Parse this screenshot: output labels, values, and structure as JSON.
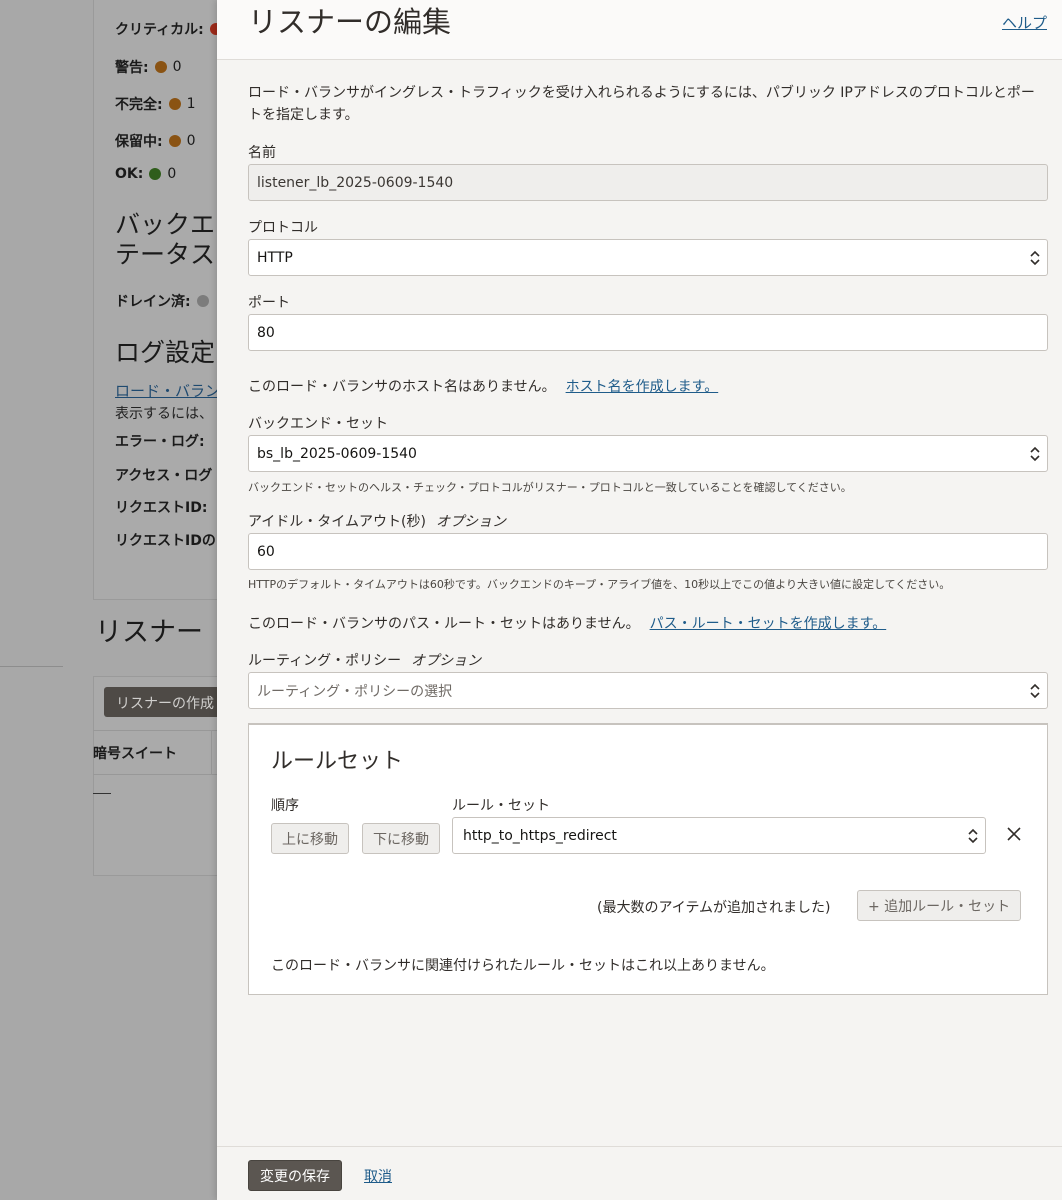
{
  "background": {
    "status": [
      {
        "label": "クリティカル:",
        "value": "",
        "color": "red"
      },
      {
        "label": "警告:",
        "value": "0",
        "color": "orange"
      },
      {
        "label": "不完全:",
        "value": "1",
        "color": "orange"
      },
      {
        "label": "保留中:",
        "value": "0",
        "color": "orange"
      },
      {
        "label": "OK:",
        "value": "0",
        "color": "green"
      }
    ],
    "backend_status_heading_1": "バックエ",
    "backend_status_heading_2": "テータス",
    "drained_label": "ドレイン済:",
    "log_heading": "ログ設定",
    "log_link": "ロード・バラン",
    "log_text": "表示するには、",
    "error_log": "エラー・ログ: ",
    "access_log": "アクセス・ログ",
    "request_id": "リクエストID: ",
    "request_id_2": "リクエストIDの",
    "listener_heading": "リスナー",
    "create_listener_button": "リスナーの作成",
    "cipher_suite_col": "暗号スイート"
  },
  "panel": {
    "title": "リスナーの編集",
    "help": "ヘルプ",
    "intro": "ロード・バランサがイングレス・トラフィックを受け入れられるようにするには、パブリック IPアドレスのプロトコルとポートを指定します。",
    "name_label": "名前",
    "name_value": "listener_lb_2025-0609-1540",
    "protocol_label": "プロトコル",
    "protocol_value": "HTTP",
    "port_label": "ポート",
    "port_value": "80",
    "hostname_text": "このロード・バランサのホスト名はありません。",
    "hostname_link": "ホスト名を作成します。",
    "backend_set_label": "バックエンド・セット",
    "backend_set_value": "bs_lb_2025-0609-1540",
    "backend_set_hint": "バックエンド・セットのヘルス・チェック・プロトコルがリスナー・プロトコルと一致していることを確認してください。",
    "idle_timeout_label": "アイドル・タイムアウト(秒)",
    "optional": "オプション",
    "idle_timeout_value": "60",
    "idle_timeout_hint": "HTTPのデフォルト・タイムアウトは60秒です。バックエンドのキープ・アライブ値を、10秒以上でこの値より大きい値に設定してください。",
    "path_route_text": "このロード・バランサのパス・ルート・セットはありません。",
    "path_route_link": "パス・ルート・セットを作成します。",
    "routing_policy_label": "ルーティング・ポリシー",
    "routing_policy_placeholder": "ルーティング・ポリシーの選択",
    "ruleset": {
      "title": "ルールセット",
      "order_label": "順序",
      "rule_set_label": "ルール・セット",
      "move_up": "上に移動",
      "move_down": "下に移動",
      "selected": "http_to_https_redirect",
      "max_note": "(最大数のアイテムが追加されました)",
      "add_button": "+ 追加ルール・セット",
      "no_more": "このロード・バランサに関連付けられたルール・セットはこれ以上ありません。"
    },
    "save_button": "変更の保存",
    "cancel": "取消"
  }
}
